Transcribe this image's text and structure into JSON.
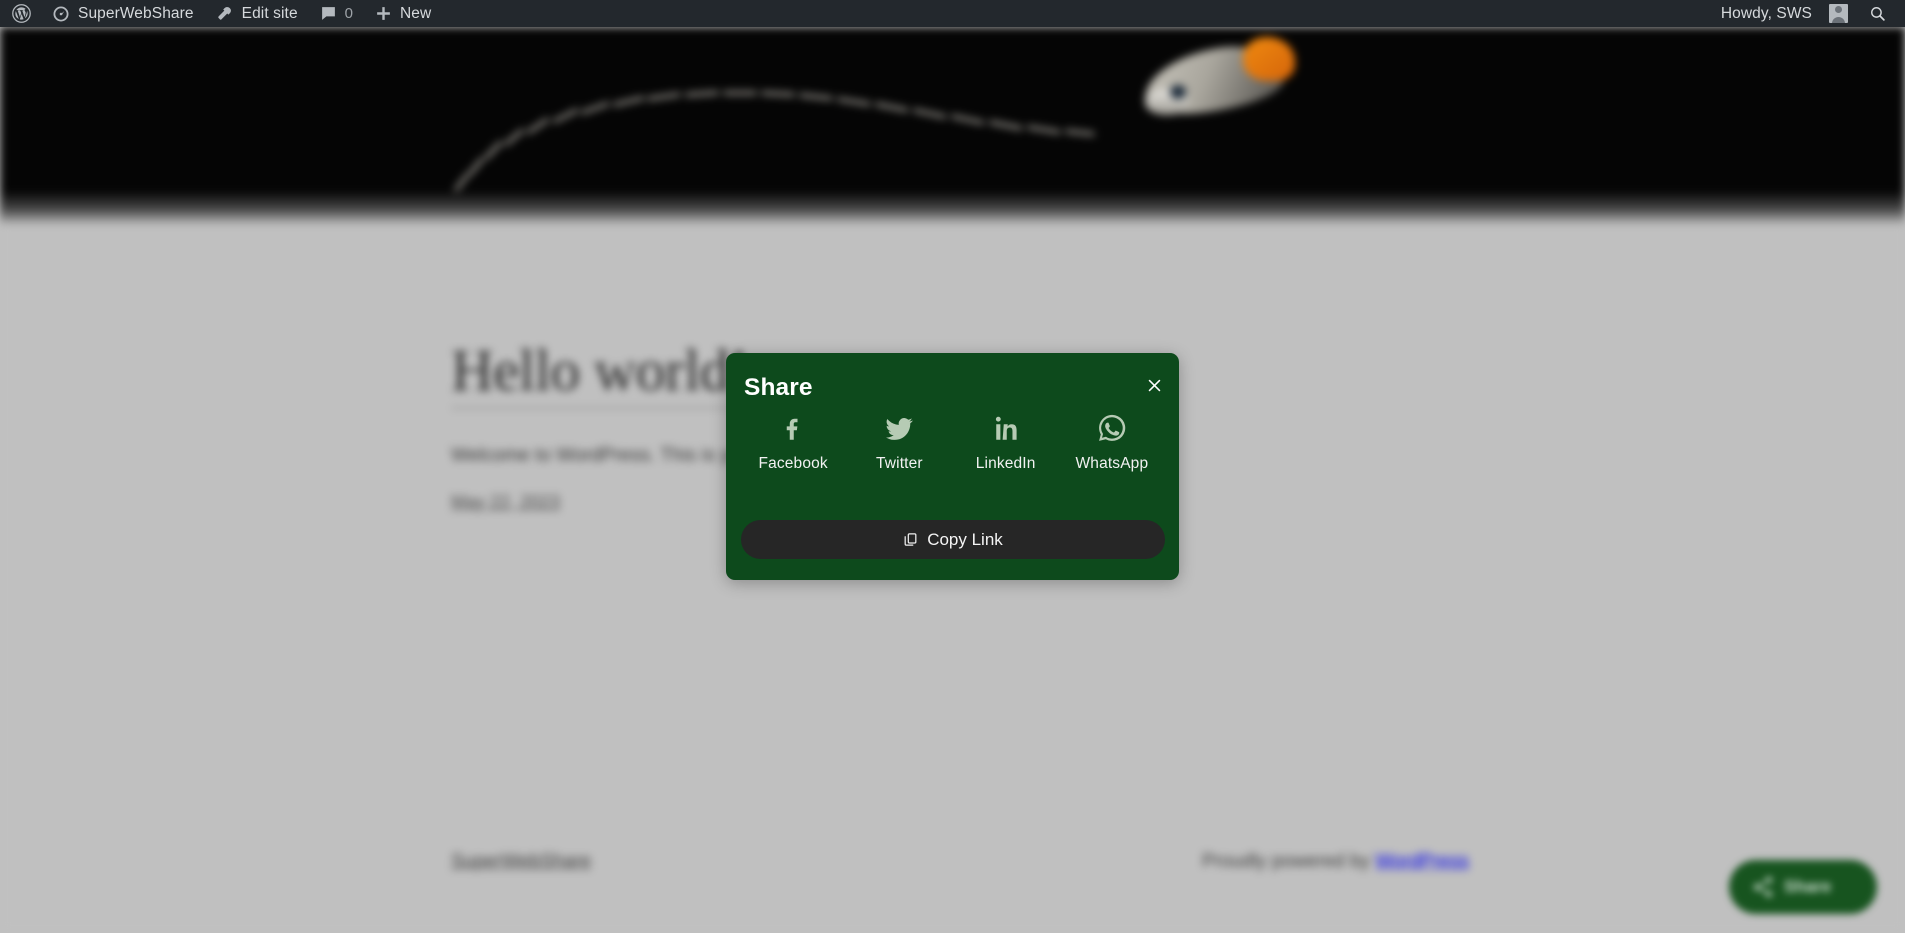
{
  "adminbar": {
    "wp_logo": "wordpress-logo-icon",
    "site_name": "SuperWebShare",
    "edit_site": "Edit site",
    "comments_count": "0",
    "new_label": "New",
    "howdy": "Howdy, SWS",
    "search": "search-icon"
  },
  "page": {
    "post_title": "Hello world!",
    "post_body": "Welcome to WordPress. This is your first post. Edit or delete it, then start writing!",
    "post_date": "May 22, 2023",
    "footer_left": "SuperWebShare",
    "footer_right_prefix": "Proudly powered by ",
    "footer_right_link": "WordPress"
  },
  "float_button": {
    "label": "Share",
    "icon": "share-nodes-icon",
    "color": "#17541f"
  },
  "modal": {
    "title": "Share",
    "close_label": "×",
    "background": "#0d4a1c",
    "icon_color": "#b6cbb4",
    "socials": [
      {
        "label": "Facebook",
        "icon": "facebook-icon"
      },
      {
        "label": "Twitter",
        "icon": "twitter-bird-icon"
      },
      {
        "label": "LinkedIn",
        "icon": "linkedin-icon"
      },
      {
        "label": "WhatsApp",
        "icon": "whatsapp-icon"
      }
    ],
    "copy_link_label": "Copy Link",
    "copy_link_icon": "copy-icon",
    "copy_link_bg": "#262626"
  }
}
